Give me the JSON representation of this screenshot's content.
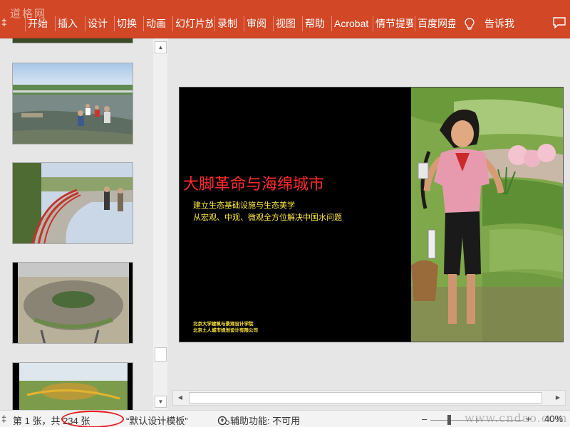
{
  "ribbon": {
    "watermark": "道格网",
    "prefix": "‡",
    "tabs": [
      "开始",
      "插入",
      "设计",
      "切换",
      "动画",
      "幻灯片放映",
      "录制",
      "审阅",
      "视图",
      "帮助",
      "Acrobat",
      "情节提要",
      "百度网盘"
    ],
    "tell_me": "告诉我"
  },
  "slide": {
    "title": "大脚革命与海绵城市",
    "subtitle_lines": [
      "建立生态基础设施与生态美学",
      "从宏观、中观、微观全方位解决中国水问题"
    ],
    "affiliations": [
      "北京大学建筑与景观设计学院",
      "北京土人城市规划设计有限公司"
    ]
  },
  "status": {
    "prefix": "‡",
    "slide_position": "第 1 张，共 234 张",
    "template": "“默认设计模板”",
    "accessibility": "辅助功能: 不可用",
    "zoom_minus": "–",
    "zoom_plus": "+",
    "zoom": "40%",
    "watermark": "www.cndao.com"
  },
  "colors": {
    "ribbon": "#d24726",
    "slide_title": "#ff2a2a",
    "slide_text": "#ffe93c",
    "annotation": "#e31a1a"
  }
}
